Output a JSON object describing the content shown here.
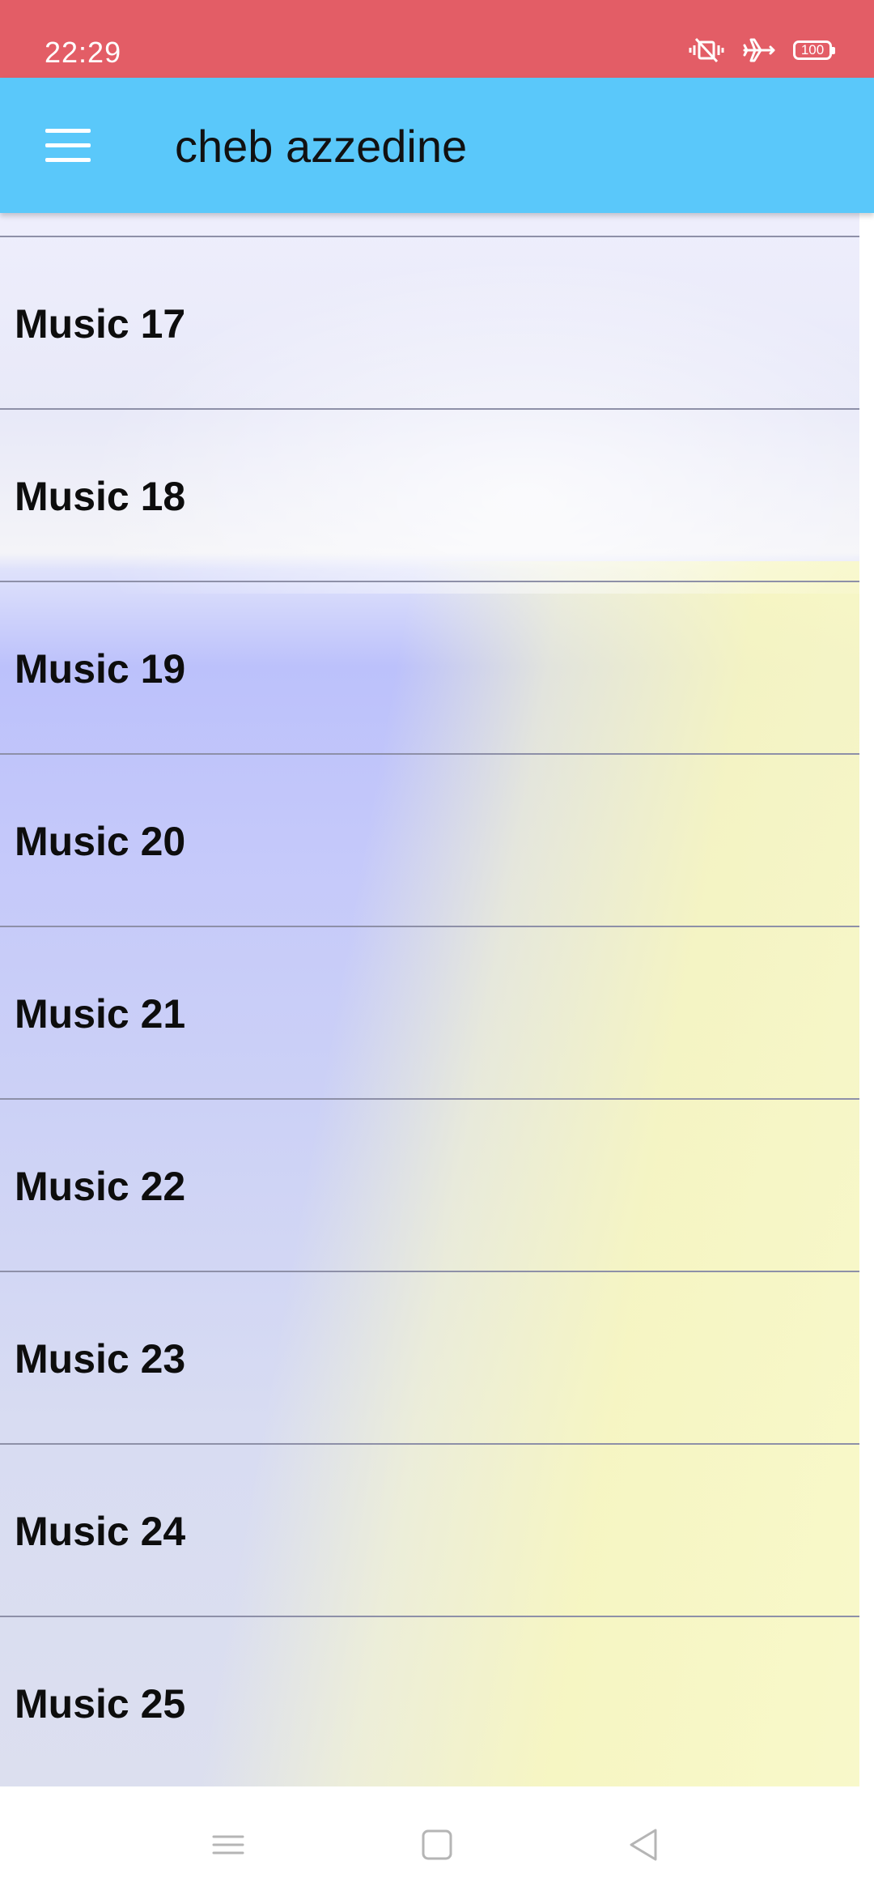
{
  "status_bar": {
    "time": "22:29",
    "battery_level": "100",
    "icons": [
      "mute-vibrate-icon",
      "airplane-mode-icon",
      "battery-icon"
    ],
    "background_color": "#e35d66"
  },
  "app_bar": {
    "title": "cheb azzedine",
    "menu_icon": "hamburger-menu-icon",
    "background_color": "#5ac8fa"
  },
  "list": {
    "items": [
      {
        "label": "Music 17"
      },
      {
        "label": "Music 18"
      },
      {
        "label": "Music 19"
      },
      {
        "label": "Music 20"
      },
      {
        "label": "Music 21"
      },
      {
        "label": "Music 22"
      },
      {
        "label": "Music 23"
      },
      {
        "label": "Music 24"
      },
      {
        "label": "Music 25"
      }
    ]
  },
  "nav_bar": {
    "buttons": [
      "recents-icon",
      "home-icon",
      "back-icon"
    ]
  }
}
